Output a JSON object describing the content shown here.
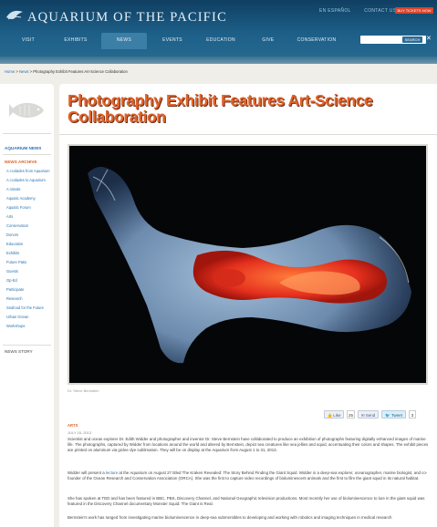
{
  "header": {
    "logo_text": "AQUARIUM OF THE PACIFIC",
    "top_links": [
      "EN ESPAÑOL",
      "CONTACT US"
    ],
    "buy_tickets": "BUY TICKETS NOW",
    "nav": [
      "VISIT",
      "EXHIBITS",
      "NEWS",
      "EVENTS",
      "EDUCATION",
      "GIVE",
      "CONSERVATION"
    ],
    "active_nav": "NEWS",
    "search_button": "SEARCH",
    "close_label": "✕"
  },
  "breadcrumb": {
    "home": "Home",
    "news": "News",
    "current": "Photography Exhibit Features Art-Science Collaboration",
    "sep": ">"
  },
  "sidebar": {
    "aquarium_news": "AQUARIUM NEWS",
    "news_archive": "NEWS ARCHIVE",
    "items": [
      "A ccolades from Aquarium",
      "A ccolades to Aquarium",
      "A nimals",
      "Aquatic Academy",
      "Aquatic Forum",
      "Arts",
      "Conservation",
      "Donors",
      "Education",
      "Exhibits",
      "Future Patio",
      "Guests",
      "Op-Ed",
      "Participate",
      "Research",
      "Seafood for the Future",
      "Urban Ocean",
      "Workshops"
    ],
    "news_story": "NEWS STORY"
  },
  "article": {
    "title": "Photography Exhibit Features Art-Science Collaboration",
    "photo_credit": "Dr. Steve Bernstein",
    "share": {
      "like": "Like",
      "like_count": "25",
      "send": "Send",
      "tweet": "Tweet",
      "tweet_count": "3"
    },
    "category": "ARTS",
    "date": "JULY 16, 2013",
    "p1": "Scientist and ocean explorer Dr. Edith Widder and photographer and inventor Dr. Steve Bernstein have collaborated to produce an exhibition of photographs featuring digitally enhanced images of marine life. The photographs, captured by Widder from locations around the world and altered by Bernstein, depict sea creatures like sea jellies and squid, accentuating their colors and shapes. The exhibit pieces are printed on aluminum via giclee dye sublimation. They will be on display at the Aquarium from August 1 to 31, 2013.",
    "p2_a": "Widder will present a ",
    "p2_link": "lecture",
    "p2_b": " at the Aquarium on August 27 titled The Kraken Revealed: The Story Behind Finding the Giant Squid. Widder is a deep-sea explorer, oceanographer, marine biologist, and co-founder of the Ocean Research and Conservation Association (ORCA). She was the first to capture video recordings of bioluminescent animals and the first to film the giant squid in its natural habitat.",
    "p3": "She has spoken at TED and has been featured in BBC, PBS, Discovery Channel, and National Geographic television productions. Most recently her use of bioluminescence to lure in the giant squid was featured in the Discovery Channel documentary Monster Squid: The Giant is Real.",
    "p4": "Bernstein's work has ranged from investigating marine bioluminescence in deep-sea submersibles to developing and working with robotics and imaging techniques in medical research"
  },
  "colors": {
    "header_blue": "#1d5f88",
    "title_orange": "#e0642b",
    "link_blue": "#2a72b0",
    "buy_button_red": "#d7452c"
  }
}
